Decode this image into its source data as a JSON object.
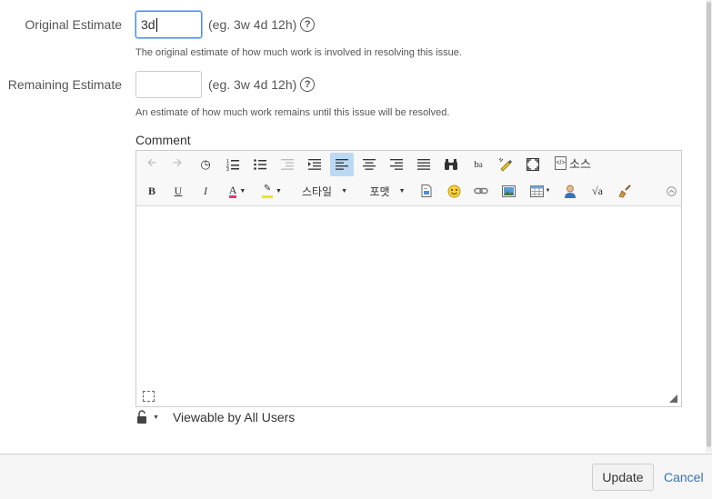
{
  "original_estimate": {
    "label": "Original Estimate",
    "value": "3d",
    "hint": "(eg. 3w 4d 12h)",
    "help_icon": "question-circle-icon",
    "description": "The original estimate of how much work is involved in resolving this issue."
  },
  "remaining_estimate": {
    "label": "Remaining Estimate",
    "value": "",
    "hint": "(eg. 3w 4d 12h)",
    "help_icon": "question-circle-icon",
    "description": "An estimate of how much work remains until this issue will be resolved."
  },
  "comment": {
    "label": "Comment",
    "toolbar": {
      "row1": [
        "undo",
        "redo",
        "history",
        "numbered-list",
        "bullet-list",
        "outdent",
        "indent",
        "align-left",
        "align-center",
        "align-right",
        "justify",
        "find",
        "replace",
        "format-painter",
        "maximize"
      ],
      "source_label": "소스",
      "row2": [
        "bold",
        "underline",
        "italic",
        "text-color",
        "highlight-color"
      ],
      "style_label": "스타일",
      "format_label": "포맷",
      "row2_icons": [
        "template",
        "emoticon",
        "link",
        "image",
        "table",
        "user",
        "math",
        "clean"
      ]
    },
    "value": ""
  },
  "visibility": {
    "icon": "unlock-icon",
    "label": "Viewable by All Users"
  },
  "footer": {
    "update_label": "Update",
    "cancel_label": "Cancel"
  }
}
